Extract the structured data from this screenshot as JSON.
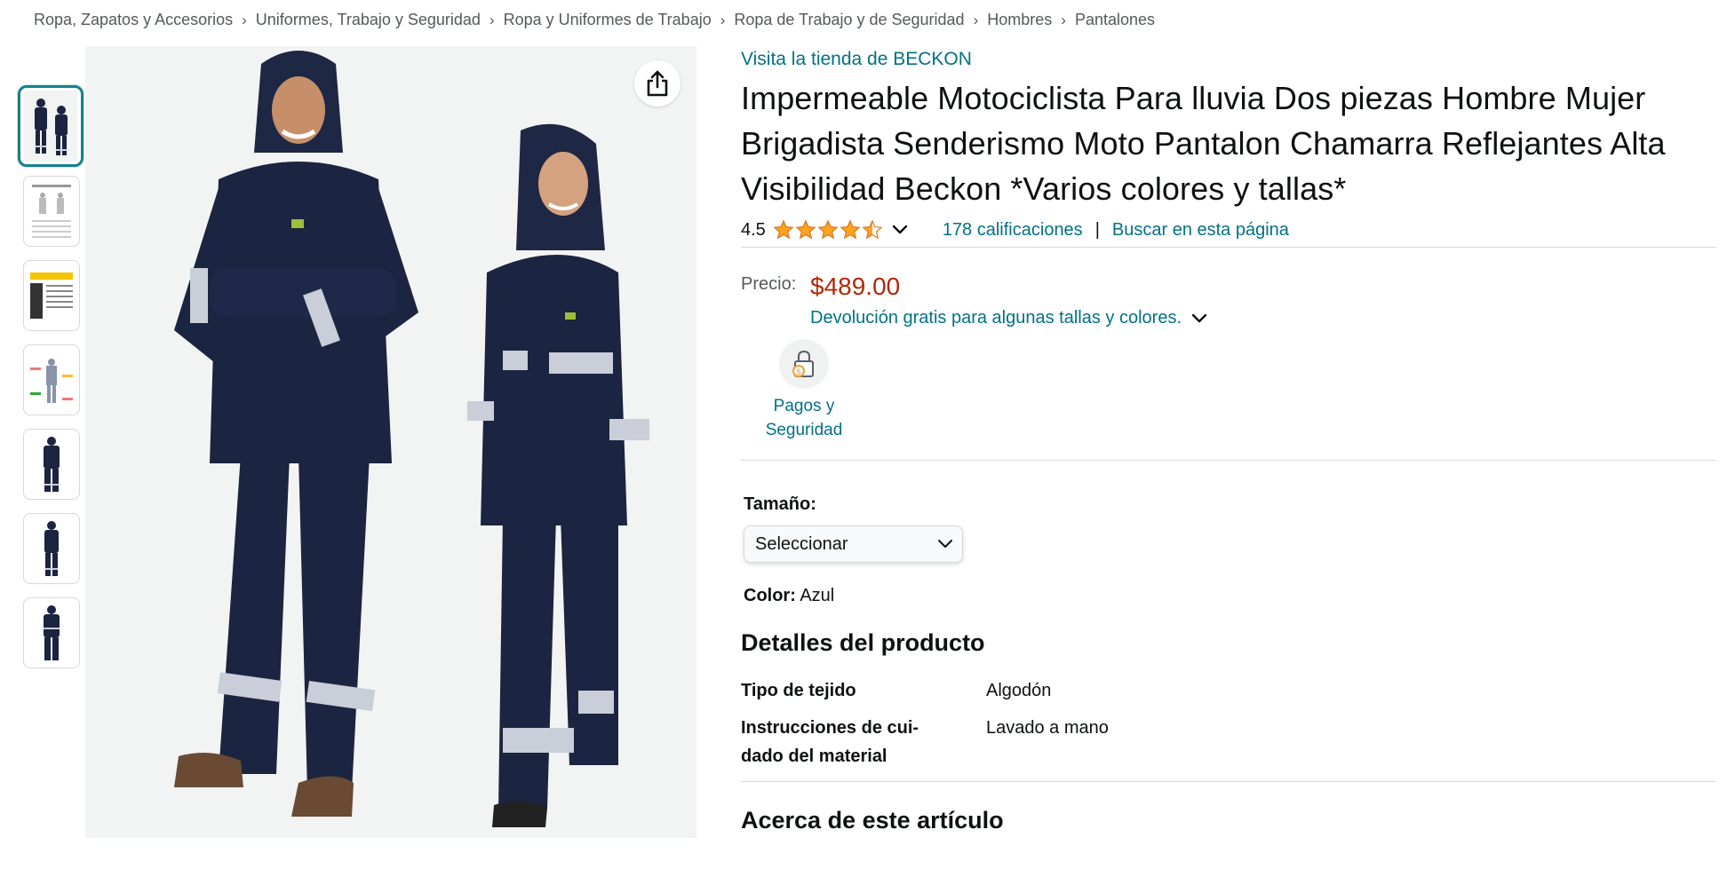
{
  "breadcrumb": [
    "Ropa, Zapatos y Accesorios",
    "Uniformes, Trabajo y Seguridad",
    "Ropa y Uniformes de Trabajo",
    "Ropa de Trabajo y de Seguridad",
    "Hombres",
    "Pantalones"
  ],
  "breadcrumb_separator": "›",
  "product": {
    "store_link": "Visita la tienda de BECKON",
    "title": "Impermeable Motociclista Para lluvia Dos piezas Hombre Mujer Brigadista Senderismo Moto Pantalon Chamarra Reflejantes Alta Visibilidad Beckon *Varios colores y tallas*",
    "rating_value": "4.5",
    "rating_stars": 4.5,
    "ratings_count_link": "178 calificaciones",
    "rating_separator": "|",
    "search_page_link": "Buscar en esta página",
    "price_label": "Precio:",
    "price": "$489.00",
    "return_text": "Devolución gratis para algunas tallas y colores.",
    "badge_label": "Pagos y Seguridad",
    "size_label": "Tamaño:",
    "size_select_value": "Seleccionar",
    "color_label": "Color:",
    "color_value": "Azul"
  },
  "details": {
    "heading": "Detalles del producto",
    "rows": [
      {
        "key": "Tipo de tejido",
        "value": "Algodón"
      },
      {
        "key": "Instrucciones de cui-\ndado del material",
        "value": "Lavado a mano"
      }
    ]
  },
  "about_heading": "Acerca de este artículo",
  "thumbnails": [
    "thumb-1",
    "thumb-2",
    "thumb-3",
    "thumb-4",
    "thumb-5",
    "thumb-6",
    "thumb-7"
  ],
  "colors": {
    "link": "#007185",
    "price": "#b12704",
    "star": "#ffa41c",
    "selected_thumb": "#1a7f8e",
    "suit": "#1b2440"
  },
  "icons": {
    "share": "share-icon",
    "chevron": "chevron-down-icon",
    "badge": "lock-shield-icon"
  }
}
